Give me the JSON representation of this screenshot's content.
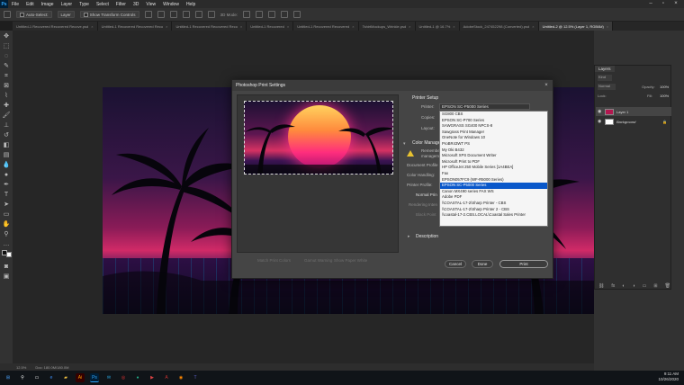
{
  "menu": {
    "app_logo": "Ps",
    "items": [
      "File",
      "Edit",
      "Image",
      "Layer",
      "Type",
      "Select",
      "Filter",
      "3D",
      "View",
      "Window",
      "Help"
    ]
  },
  "options_bar": {
    "auto_select_label": "Auto-Select:",
    "auto_select_target": "Layer",
    "show_transform_label": "Show Transform Controls",
    "mode_3d": "3D Mode:"
  },
  "tabs": [
    {
      "label": "Untitled-1 Recovered Recovered Recove.psd",
      "active": false
    },
    {
      "label": "Untitled-1 Recovered Recovered Reco",
      "active": false
    },
    {
      "label": "Untitled-1 Recovered Recovered Reco",
      "active": false
    },
    {
      "label": "Untitled-1 Recovered",
      "active": false
    },
    {
      "label": "Untitled-1 Recovered Recovered",
      "active": false
    },
    {
      "label": "TshirtMockups_Wrinkle.psd",
      "active": false
    },
    {
      "label": "Untitled-1 @ 16.7%",
      "active": false
    },
    {
      "label": "AdobeStock_247452298 (Converted).psd",
      "active": false
    },
    {
      "label": "Untitled-2 @ 12.5% (Layer 1, RGB/8#)",
      "active": true
    }
  ],
  "status_bar": {
    "zoom": "12.5%",
    "doc_size": "Doc: 180.0M/180.0M"
  },
  "layers_panel": {
    "tab": "Layers",
    "kind_label": "Kind",
    "blend_mode": "Normal",
    "opacity_label": "Opacity:",
    "opacity_value": "100%",
    "lock_label": "Lock:",
    "fill_label": "Fill:",
    "fill_value": "100%",
    "layers": [
      {
        "name": "Layer 1",
        "selected": true,
        "thumb": "#b3174f"
      },
      {
        "name": "Background",
        "selected": false,
        "thumb": "#ffffff"
      }
    ]
  },
  "dialog": {
    "title": "Photoshop Print Settings",
    "close": "×",
    "printer_setup": "Printer Setup",
    "printer_label": "Printer:",
    "printer_value": "EPSON SC-P5000 Series",
    "copies_label": "Copies:",
    "layout_label": "Layout:",
    "color_mgmt": "Color Manage",
    "remember_text": "Remember to",
    "remember_text2": "manageme",
    "document_profile": "Document Profile",
    "color_handling": "Color Handling:",
    "printer_profile": "Printer Profile:",
    "normal_printing": "Normal Prin",
    "rendering_intent": "Rendering Inten",
    "black_point": "Black Point",
    "description": "Description",
    "match_print_colors": "Match Print Colors",
    "gamut_warning": "Gamut Warning",
    "show_paper_white": "Show Paper White",
    "cancel": "Cancel",
    "done": "Done",
    "print": "Print"
  },
  "printer_list": {
    "items": [
      "SG800 CBS",
      "EPSON SC-P700 Series",
      "SAWGRASS SG400 NPCS-8",
      "Sawgrass Print Manager",
      "OneNote for Windows 10",
      "ProBR43WT PS",
      "My Oki B432",
      "Microsoft XPS Document Writer",
      "Microsoft Print to PDF",
      "HP OfficeJet 250 Mobile Series [1A4BEA]",
      "Fax",
      "EPSON057FC9 (WF-R5000 Series)",
      "EPSON SC-P5000 Series",
      "Canon MX490 series FAX WS",
      "Adobe PDF",
      "\\\\COASTAL-17-2\\Sharp Printer - CBS",
      "\\\\COASTAL-17-2\\Sharp Printer 2 - CBS",
      "\\\\coastal-17-2.CBS.LOCAL\\Coastal Sales Printer"
    ],
    "selected_index": 12
  },
  "taskbar": {
    "time": "9:11 AM",
    "date": "10/26/2020"
  }
}
